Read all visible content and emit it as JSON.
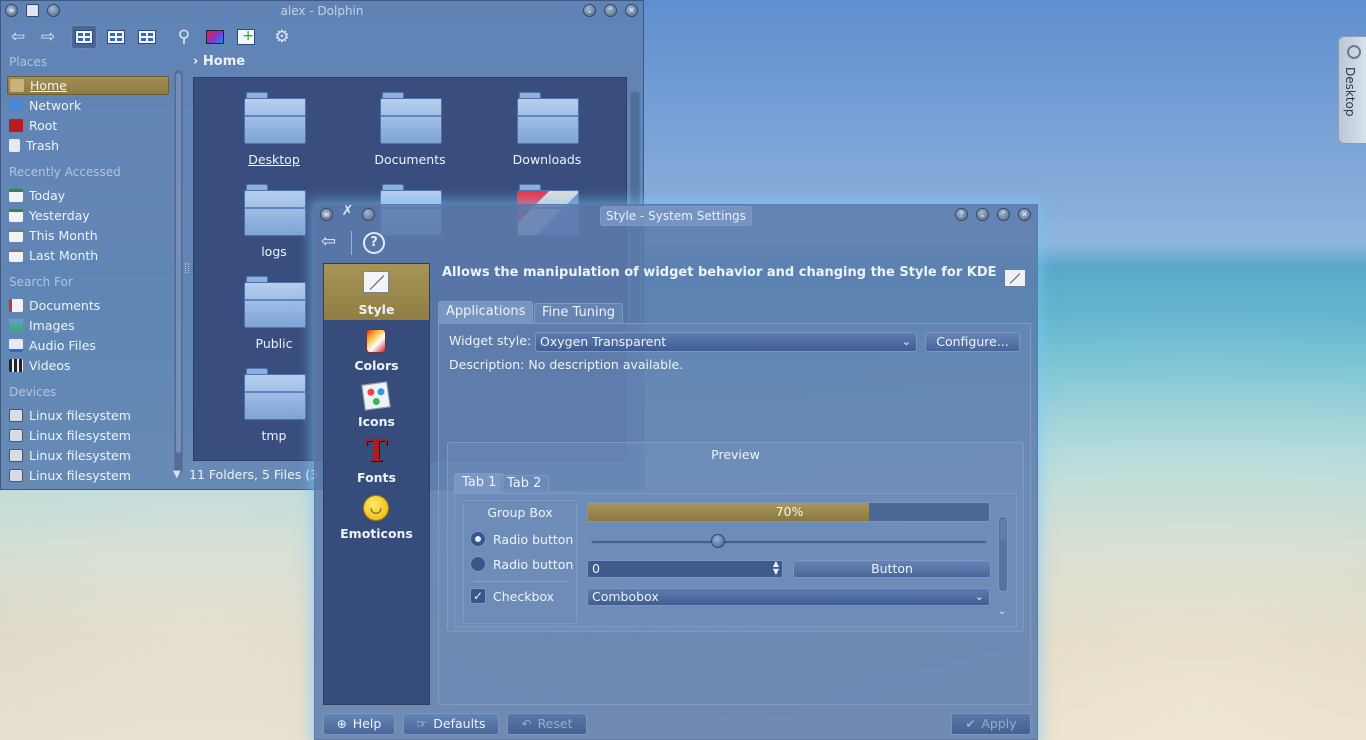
{
  "dolphin": {
    "title": "alex - Dolphin",
    "breadcrumb": "Home",
    "places_sections": [
      {
        "header": "Places",
        "items": [
          "Home",
          "Network",
          "Root",
          "Trash"
        ]
      },
      {
        "header": "Recently Accessed",
        "items": [
          "Today",
          "Yesterday",
          "This Month",
          "Last Month"
        ]
      },
      {
        "header": "Search For",
        "items": [
          "Documents",
          "Images",
          "Audio Files",
          "Videos"
        ]
      },
      {
        "header": "Devices",
        "items": [
          "Linux filesystem",
          "Linux filesystem",
          "Linux filesystem",
          "Linux filesystem"
        ]
      }
    ],
    "folders": [
      "Desktop",
      "Documents",
      "Downloads",
      "logs",
      "Public",
      "tmp"
    ],
    "status": "11 Folders, 5 Files (3"
  },
  "desktop_widget": {
    "label": "Desktop"
  },
  "settings": {
    "title": "Style - System Settings",
    "categories": [
      "Style",
      "Colors",
      "Icons",
      "Fonts",
      "Emoticons"
    ],
    "description": "Allows the manipulation of widget behavior and changing the Style for KDE",
    "tabs": [
      "Applications",
      "Fine Tuning"
    ],
    "widget_style_label": "Widget style:",
    "widget_style_value": "Oxygen Transparent",
    "configure_label": "Configure...",
    "description_text": "Description: No description available.",
    "preview": {
      "title": "Preview",
      "tabs": [
        "Tab 1",
        "Tab 2"
      ],
      "group_box_title": "Group Box",
      "radio1": "Radio button",
      "radio2": "Radio button",
      "checkbox": "Checkbox",
      "progress_text": "70%",
      "progress_value": 0.7,
      "slider_value": 0.32,
      "spin_value": "0",
      "button_label": "Button",
      "combobox_value": "Combobox"
    },
    "buttons": {
      "help": "Help",
      "defaults": "Defaults",
      "reset": "Reset",
      "apply": "Apply"
    }
  }
}
